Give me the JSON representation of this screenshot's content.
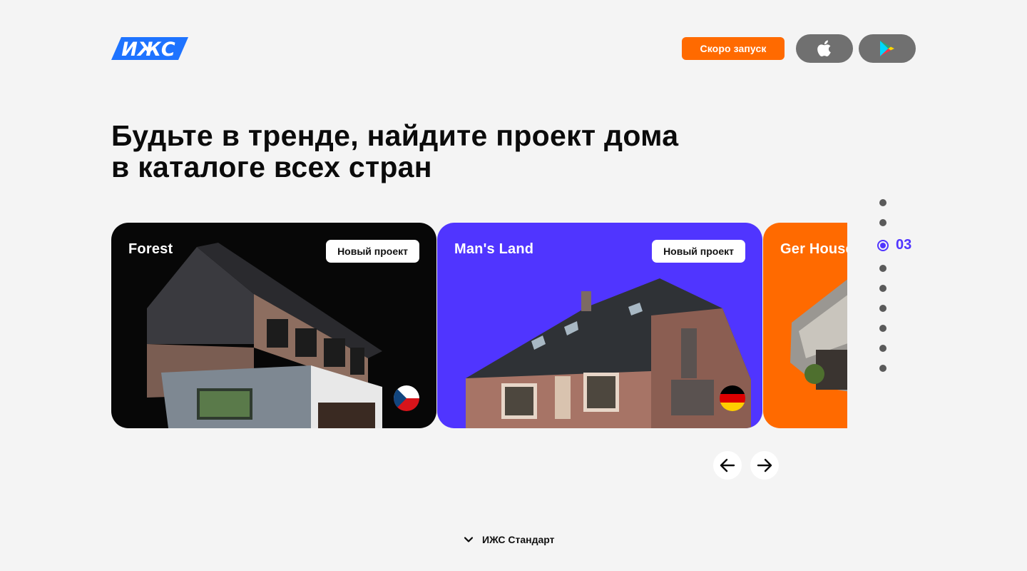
{
  "header": {
    "logo_text": "ИЖС",
    "soon_label": "Скоро запуск",
    "app_store_icon": "apple-icon",
    "google_play_icon": "google-play-icon"
  },
  "headline": {
    "line1": "Будьте в тренде, найдите проект дома",
    "line2": "в каталоге всех стран"
  },
  "cards": [
    {
      "title": "Forest",
      "badge": "Новый проект",
      "flag": "czech-flag-icon",
      "color": "#070707"
    },
    {
      "title": "Man's Land",
      "badge": "Новый проект",
      "flag": "germany-flag-icon",
      "color": "#5035ff"
    },
    {
      "title": "Ger House",
      "color": "#ff6a00"
    }
  ],
  "pager": {
    "active_number": "03",
    "active_color": "#5035ff"
  },
  "footer": {
    "toggle_label": "ИЖС Стандарт"
  }
}
